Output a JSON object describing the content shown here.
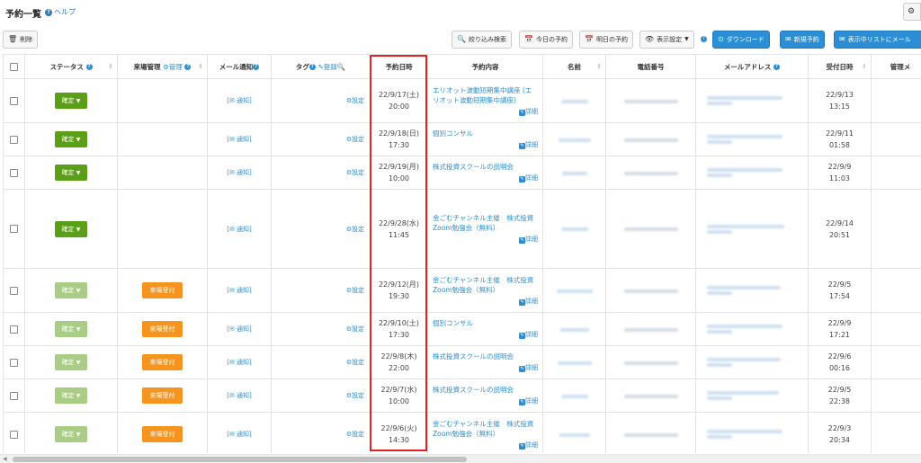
{
  "header": {
    "title": "予約一覧",
    "help_label": "ヘルプ",
    "gear_label": "⚙"
  },
  "toolbar": {
    "delete_label": "削除",
    "filter_label": "絞り込み検索",
    "today_label": "今日の予約",
    "tomorrow_label": "明日の予約",
    "display_label": "表示設定",
    "download_label": "ダウンロード",
    "new_label": "新規予約",
    "email_list_label": "表示中リストにメール"
  },
  "columns": {
    "status": "ステータス",
    "visit": "来場管理",
    "visit_manage": "管理",
    "mail": "メール通知",
    "tag": "タグ",
    "tag_register": "登録",
    "datetime": "予約日時",
    "content": "予約内容",
    "name": "名前",
    "phone": "電話番号",
    "email": "メールアドレス",
    "received": "受付日時",
    "admin": "管理メ"
  },
  "labels": {
    "confirm": "確定",
    "visit_btn": "来場受付",
    "notify": "[✉ 通知]",
    "tag_setting": "設定",
    "detail": "詳細"
  },
  "rows": [
    {
      "status": "confirm",
      "muted": false,
      "visit": false,
      "date": "22/9/17(土)",
      "time": "20:00",
      "content": "エリオット波動短期集中講座 (エリオット波動短期集中講座)",
      "received_date": "22/9/13",
      "received_time": "13:15",
      "h": 49
    },
    {
      "status": "confirm",
      "muted": false,
      "visit": false,
      "date": "22/9/18(日)",
      "time": "17:30",
      "content": "個別コンサル",
      "received_date": "22/9/11",
      "received_time": "01:58",
      "h": 37
    },
    {
      "status": "confirm",
      "muted": false,
      "visit": false,
      "date": "22/9/19(月)",
      "time": "10:00",
      "content": "株式投資スクールの説明会",
      "received_date": "22/9/9",
      "received_time": "11:03",
      "h": 37
    },
    {
      "status": "confirm",
      "muted": false,
      "visit": false,
      "date": "22/9/28(水)",
      "time": "11:45",
      "content": "金ごむチャンネル主催　株式投資Zoom勉強会（無料）",
      "received_date": "22/9/14",
      "received_time": "20:51",
      "h": 88
    },
    {
      "status": "confirm",
      "muted": true,
      "visit": true,
      "date": "22/9/12(月)",
      "time": "19:30",
      "content": "金ごむチャンネル主催　株式投資Zoom勉強会（無料）",
      "received_date": "22/9/5",
      "received_time": "17:54",
      "h": 49
    },
    {
      "status": "confirm",
      "muted": true,
      "visit": true,
      "date": "22/9/10(土)",
      "time": "17:30",
      "content": "個別コンサル",
      "received_date": "22/9/9",
      "received_time": "17:21",
      "h": 37
    },
    {
      "status": "confirm",
      "muted": true,
      "visit": true,
      "date": "22/9/8(木)",
      "time": "22:00",
      "content": "株式投資スクールの説明会",
      "received_date": "22/9/6",
      "received_time": "00:16",
      "h": 37
    },
    {
      "status": "confirm",
      "muted": true,
      "visit": true,
      "date": "22/9/7(水)",
      "time": "10:00",
      "content": "株式投資スクールの説明会",
      "received_date": "22/9/5",
      "received_time": "22:38",
      "h": 37
    },
    {
      "status": "confirm",
      "muted": true,
      "visit": true,
      "date": "22/9/6(火)",
      "time": "14:30",
      "content": "金ごむチャンネル主催　株式投資Zoom勉強会（無料）",
      "received_date": "22/9/3",
      "received_time": "20:34",
      "h": 49
    }
  ]
}
